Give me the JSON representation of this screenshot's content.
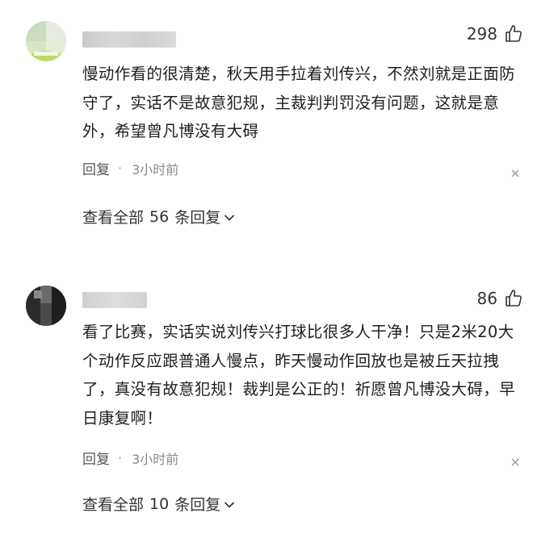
{
  "comments": [
    {
      "likes": "298",
      "text": "慢动作看的很清楚，秋天用手拉着刘传兴，不然刘就是正面防守了，实话不是故意犯规，主裁判判罚没有问题，这就是意外，希望曾凡博没有大碍",
      "reply_label": "回复",
      "separator_dot": "·",
      "time": "3小时前",
      "view_all_prefix": "查看全部",
      "reply_count": "56",
      "view_all_suffix": "条回复"
    },
    {
      "likes": "86",
      "text": "看了比赛，实话实说刘传兴打球比很多人干净！只是2米20大个动作反应跟普通人慢点，昨天慢动作回放也是被丘天拉拽了，真没有故意犯规！裁判是公正的！祈愿曾凡博没大碍，早日康复啊！",
      "reply_label": "回复",
      "separator_dot": "·",
      "time": "3小时前",
      "view_all_prefix": "查看全部",
      "reply_count": "10",
      "view_all_suffix": "条回复"
    }
  ],
  "icons": {
    "like": "thumbs-up-icon",
    "more": "close-icon",
    "expand": "chevron-down-icon"
  }
}
